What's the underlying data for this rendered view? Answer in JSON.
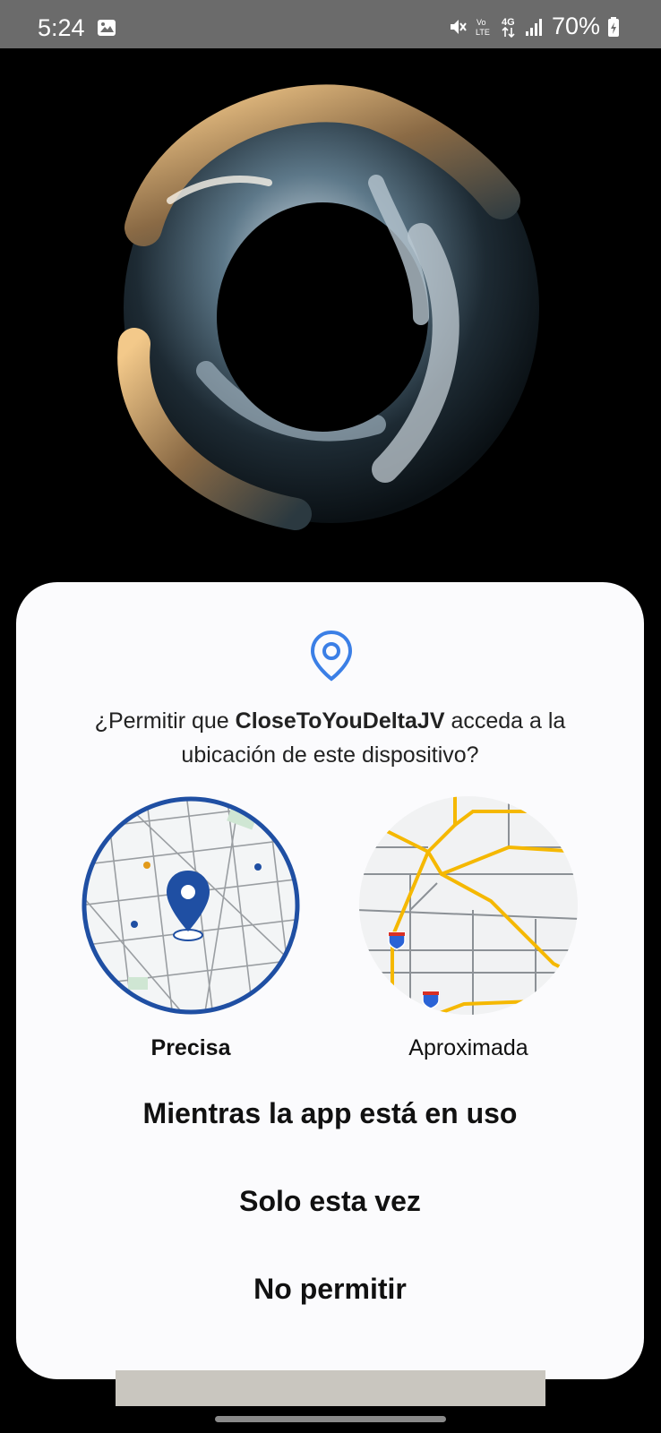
{
  "status_bar": {
    "time": "5:24",
    "battery": "70%",
    "icons": [
      "gallery-icon",
      "mute-icon",
      "volte-icon",
      "4g-icon",
      "signal-icon",
      "battery-charging-icon"
    ]
  },
  "dialog": {
    "icon": "location-pin-icon",
    "question": {
      "prefix": "¿Permitir que ",
      "app_name": "CloseToYouDeltaJV",
      "suffix": " acceda a la ubicación de este dispositivo?"
    },
    "precision_options": [
      {
        "label": "Precisa",
        "selected": true
      },
      {
        "label": "Aproximada",
        "selected": false
      }
    ],
    "actions": [
      "Mientras la app está en uso",
      "Solo esta vez",
      "No permitir"
    ]
  },
  "colors": {
    "accent": "#1f4fa3",
    "pin": "#3b7fe6",
    "road_major": "#f5b800",
    "dialog_bg": "#fbfbfd"
  }
}
